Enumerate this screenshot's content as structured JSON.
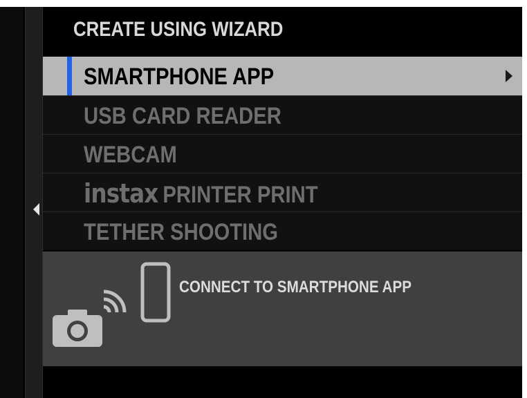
{
  "menu": {
    "title": "CREATE USING WIZARD",
    "items": [
      {
        "label": "SMARTPHONE APP",
        "selected": true,
        "has_submenu": true
      },
      {
        "label": "USB CARD READER",
        "selected": false
      },
      {
        "label": "WEBCAM",
        "selected": false
      },
      {
        "brand": "instax",
        "label": "PRINTER PRINT",
        "selected": false
      },
      {
        "label": "TETHER SHOOTING",
        "selected": false
      }
    ]
  },
  "info": {
    "text": "CONNECT TO SMARTPHONE APP",
    "icons": [
      "camera-icon",
      "wireless-signal-icon",
      "smartphone-icon"
    ]
  },
  "icons": {
    "back": "chevron-left-icon",
    "submenu": "chevron-right-icon"
  },
  "colors": {
    "background": "#000000",
    "item_background": "#111111",
    "selected_background": "#b7b7b7",
    "selection_accent": "#1f63e6",
    "inactive_text": "#6e6e6e",
    "info_panel": "#404040"
  }
}
